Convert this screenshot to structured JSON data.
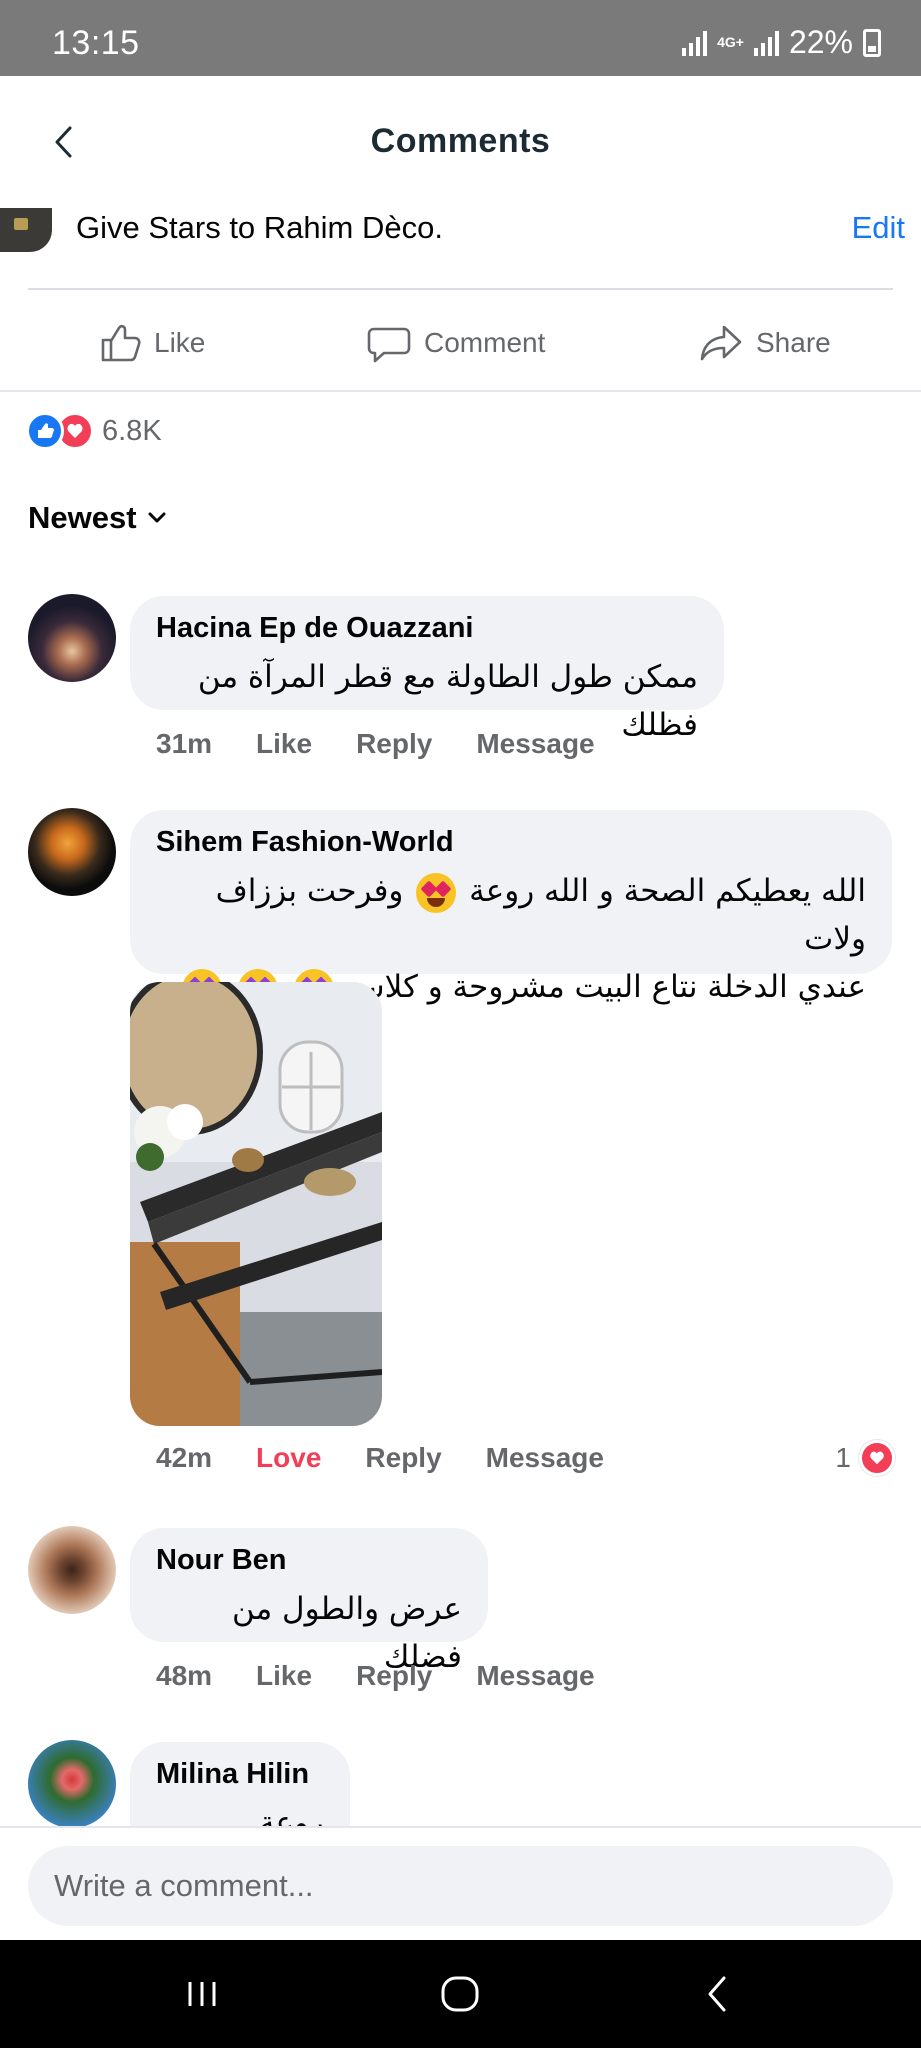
{
  "status": {
    "time": "13:15",
    "network_label": "4G+",
    "battery": "22%"
  },
  "header": {
    "title": "Comments",
    "back_icon": "chevron-left-icon"
  },
  "post": {
    "banner_text": "Give Stars to Rahim Dèco.",
    "edit_label": "Edit"
  },
  "actions": {
    "like": "Like",
    "comment": "Comment",
    "share": "Share"
  },
  "reactions": {
    "count": "6.8K",
    "types": [
      "like",
      "love"
    ]
  },
  "sort": {
    "label": "Newest"
  },
  "comments": [
    {
      "name": "Hacina Ep de Ouazzani",
      "text": "ممكن طول الطاولة مع قطر المرآة من فظلك",
      "time": "31m",
      "action": "Like",
      "reply": "Reply",
      "message": "Message"
    },
    {
      "name": "Sihem Fashion-World",
      "text_line1": "الله يعطيكم الصحة و الله روعة",
      "text_line1b": "وفرحت بززاف ولات",
      "text_line2": "عندي الدخلة نتاع البيت مشروحة و كلاس",
      "time": "42m",
      "action": "Love",
      "reply": "Reply",
      "message": "Message",
      "reaction_count": "1",
      "has_photo": true
    },
    {
      "name": "Nour Ben",
      "text": "عرض والطول من فضلك",
      "time": "48m",
      "action": "Like",
      "reply": "Reply",
      "message": "Message"
    },
    {
      "name": "Milina Hilin",
      "text": "روعة"
    }
  ],
  "composer": {
    "placeholder": "Write a comment..."
  },
  "colors": {
    "status_bar": "#7a7a7a",
    "accent_blue": "#1877f2",
    "love_red": "#f33e58",
    "bubble_bg": "#f0f2f5",
    "meta_gray": "#65676b"
  }
}
